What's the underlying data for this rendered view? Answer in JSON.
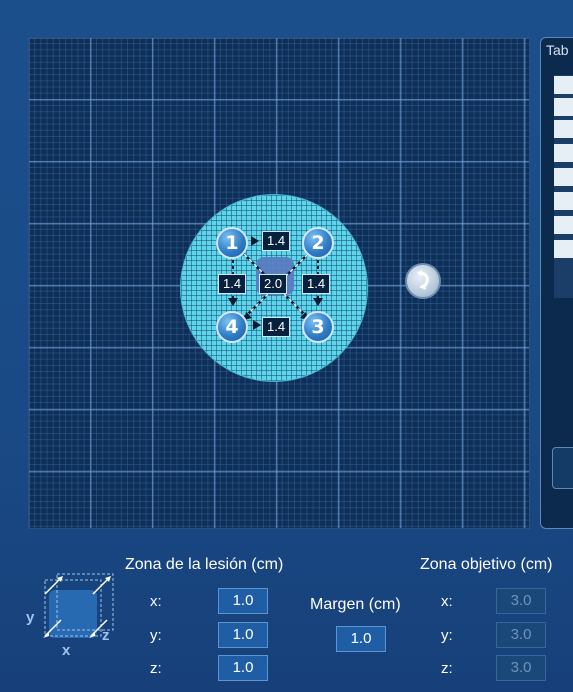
{
  "grid": {
    "points": [
      {
        "number": "1"
      },
      {
        "number": "2"
      },
      {
        "number": "3"
      },
      {
        "number": "4"
      }
    ],
    "distances": {
      "top": "1.4",
      "left": "1.4",
      "center": "2.0",
      "right": "1.4",
      "bottom": "1.4"
    }
  },
  "side_panel": {
    "title": "Tab"
  },
  "lesion_zone": {
    "title": "Zona de la lesión (cm)",
    "x_label": "x:",
    "x": "1.0",
    "y_label": "y:",
    "y": "1.0",
    "z_label": "z:",
    "z": "1.0"
  },
  "margin": {
    "label": "Margen (cm)",
    "value": "1.0"
  },
  "target_zone": {
    "title": "Zona objetivo (cm)",
    "x_label": "x:",
    "x": "3.0",
    "y_label": "y:",
    "y": "3.0",
    "z_label": "z:",
    "z": "3.0"
  },
  "cube_icon": {
    "axis_x": "x",
    "axis_y": "y",
    "axis_z": "z"
  },
  "icons": {
    "rotate": "rotate-icon",
    "cube": "cube-axes-icon"
  },
  "colors": {
    "background": "#1b4f8c",
    "grid": "#0e2f57",
    "lesion": "#5fd5ea",
    "field": "#1f5ea4"
  }
}
